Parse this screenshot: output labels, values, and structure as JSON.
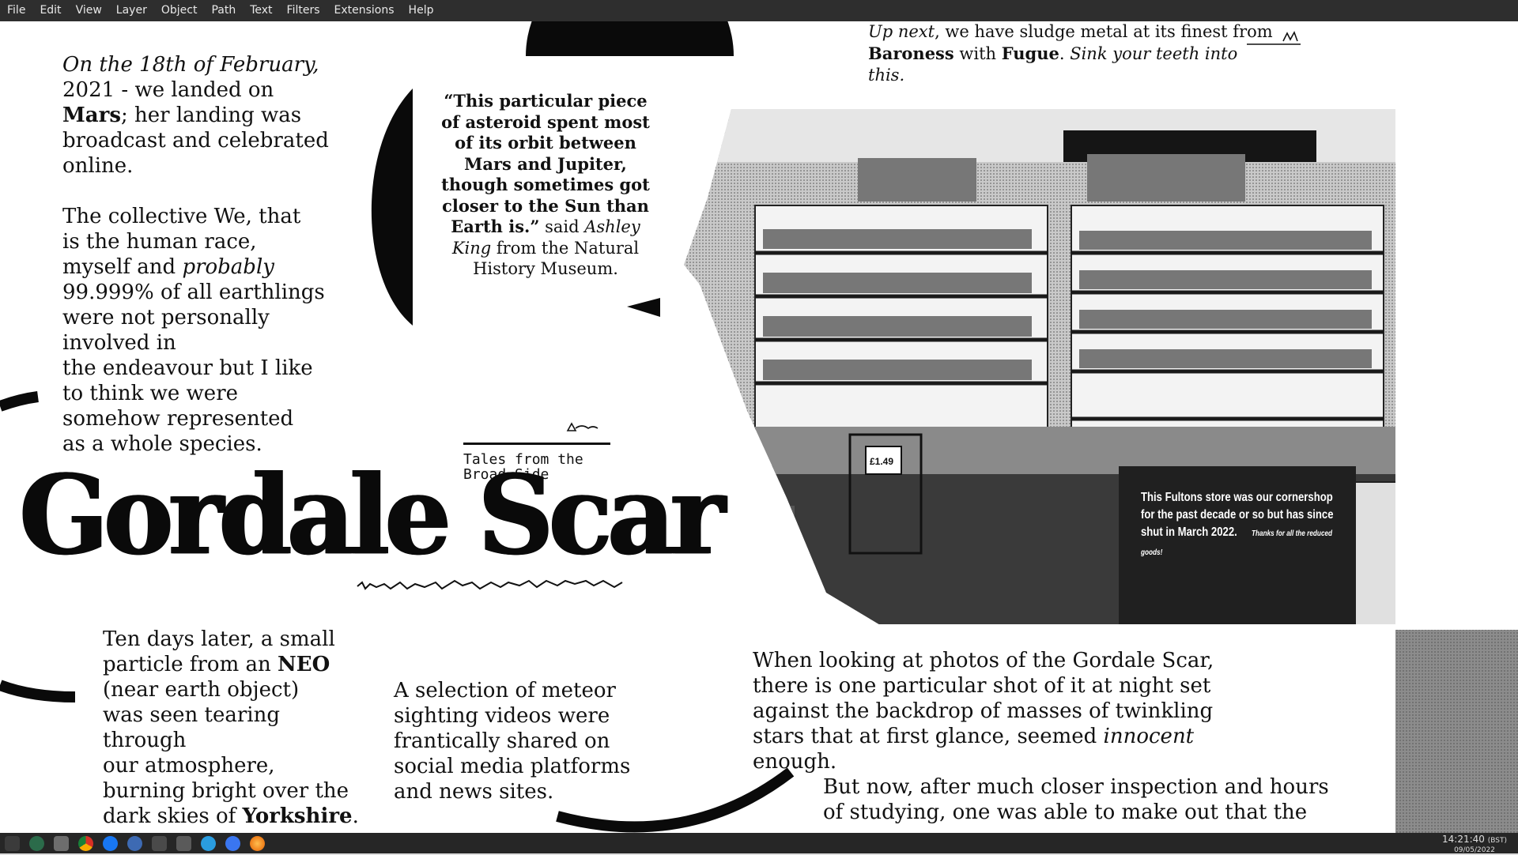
{
  "menu": [
    "File",
    "Edit",
    "View",
    "Layer",
    "Object",
    "Path",
    "Text",
    "Filters",
    "Extensions",
    "Help"
  ],
  "left_column": {
    "p1_line1": "On the 18th of February,",
    "p1_line2": "2021 - we landed on",
    "p1_line3_bold": "Mars",
    "p1_line3_rest": "; her landing was",
    "p1_line4": "broadcast and celebrated",
    "p1_line5": "online.",
    "p2_line1": "The collective We, that",
    "p2_line2": "is the human race,",
    "p2_line3a": "myself and ",
    "p2_line3b": "probably",
    "p2_line4": "99.999% of all earthlings",
    "p2_line5": "were not personally",
    "p2_line6": "involved in",
    "p2_line7": "the endeavour but I like",
    "p2_line8": "to think we were",
    "p2_line9": "somehow represented",
    "p2_line10": "as a whole species."
  },
  "quote": {
    "bold": "“This particular piece of asteroid spent most of its orbit between Mars and Jupiter, though sometimes got closer to the Sun than Earth is.”",
    "said": " said ",
    "name": "Ashley King",
    "rest": " from the Natural History Museum."
  },
  "tales": {
    "line1": "Tales from the",
    "line2": "Broad Side"
  },
  "title": "Gordale Scar",
  "top_right": {
    "l1_italic": "Up next",
    "l1_rest": ", we have sludge metal at its finest from",
    "l2_b1": "Baroness",
    "l2_with": " with ",
    "l2_b2": "Fugue",
    "l2_dot": ".",
    "l2_italic": " Sink your teeth into this."
  },
  "photo": {
    "caption_l1": "This Fultons store was our cornershop",
    "caption_l2": "for the past decade or so but has since",
    "caption_l3": "shut in March 2022.",
    "caption_small": "Thanks for all the reduced goods!",
    "price_tag": "£1.49"
  },
  "bottom_left": {
    "l1": "Ten days later, a small",
    "l2a": "particle from an ",
    "l2b": "NEO",
    "l3": "(near earth object)",
    "l4": "was seen tearing",
    "l5": "through",
    "l6": "our atmosphere,",
    "l7": "burning bright over the",
    "l8a": "dark skies of ",
    "l8b": "Yorkshire",
    "l8c": "."
  },
  "bottom_mid": {
    "l1": "A selection of meteor",
    "l2": "sighting videos were",
    "l3": "frantically shared on",
    "l4": "social media platforms",
    "l5": "and news sites."
  },
  "bottom_right": {
    "l1": "When looking at photos of the Gordale Scar,",
    "l2": "there is one particular shot of it at night set",
    "l3": "against the backdrop of masses of twinkling",
    "l4a": "stars that at first glance, seemed ",
    "l4b": "innocent",
    "l5": "enough.",
    "l6": "But now, after much closer inspection and hours",
    "l7": "of studying, one was able to make out that the"
  },
  "clock": {
    "time": "14:21:40",
    "tz": "(BST)",
    "date": "09/05/2022"
  },
  "colors": {
    "menubar": "#2e2e2e",
    "taskbar": "#262626",
    "page": "#ffffff",
    "ink": "#111111"
  },
  "taskbar_icons": [
    "app-menu-icon",
    "inkscape-icon",
    "file-manager-icon",
    "chrome-icon",
    "messenger-icon",
    "headset-icon",
    "terminal-icon",
    "inkscape-window-icon",
    "blue-app-icon",
    "signal-icon",
    "firefox-icon"
  ]
}
